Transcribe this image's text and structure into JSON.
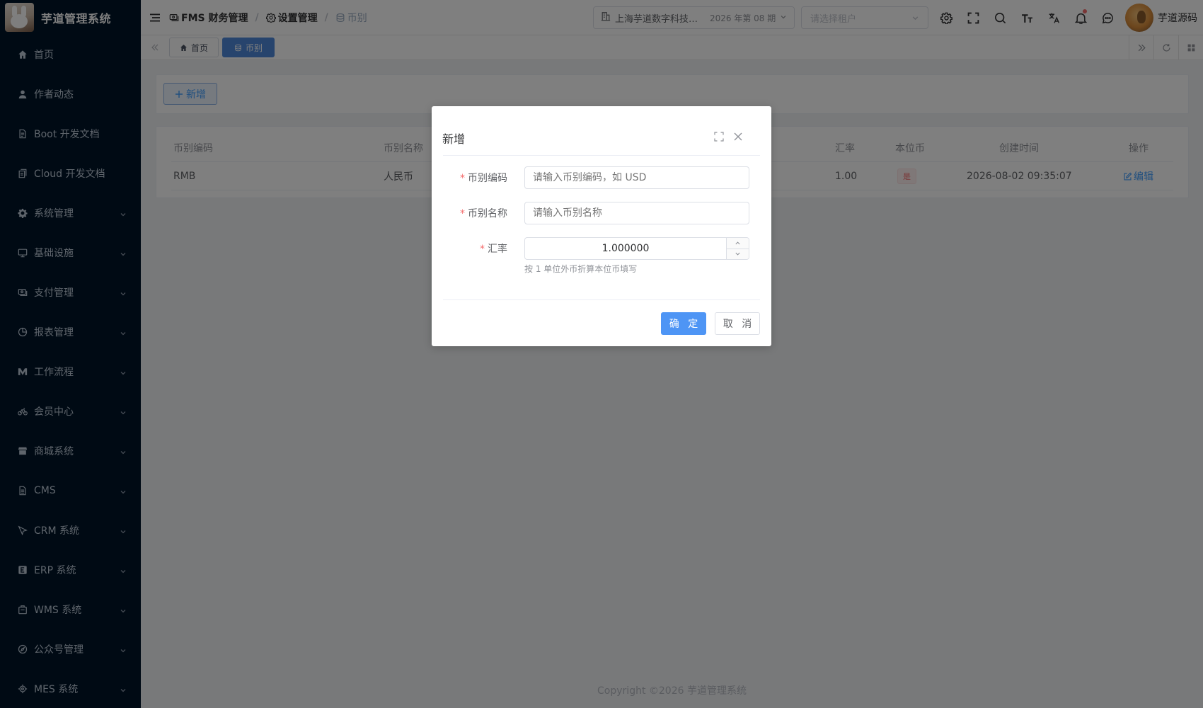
{
  "app": {
    "title": "芋道管理系统"
  },
  "sidebar": {
    "items": [
      {
        "label": "首页",
        "icon": "home-icon",
        "arrow": false
      },
      {
        "label": "作者动态",
        "icon": "user-icon",
        "arrow": false
      },
      {
        "label": "Boot 开发文档",
        "icon": "document-icon",
        "arrow": false
      },
      {
        "label": "Cloud 开发文档",
        "icon": "document-copy-icon",
        "arrow": false
      },
      {
        "label": "系统管理",
        "icon": "gear-icon",
        "arrow": true
      },
      {
        "label": "基础设施",
        "icon": "monitor-icon",
        "arrow": true
      },
      {
        "label": "支付管理",
        "icon": "payment-icon",
        "arrow": true
      },
      {
        "label": "报表管理",
        "icon": "pie-chart-icon",
        "arrow": true
      },
      {
        "label": "工作流程",
        "icon": "workflow-icon",
        "arrow": true
      },
      {
        "label": "会员中心",
        "icon": "bicycle-icon",
        "arrow": true
      },
      {
        "label": "商城系统",
        "icon": "shop-icon",
        "arrow": true
      },
      {
        "label": "CMS",
        "icon": "cms-document-icon",
        "arrow": true
      },
      {
        "label": "CRM 系统",
        "icon": "crm-icon",
        "arrow": true
      },
      {
        "label": "ERP 系统",
        "icon": "erp-icon",
        "arrow": true
      },
      {
        "label": "WMS 系统",
        "icon": "warehouse-icon",
        "arrow": true
      },
      {
        "label": "公众号管理",
        "icon": "compass-icon",
        "arrow": true
      },
      {
        "label": "MES 系统",
        "icon": "cog-icon",
        "arrow": true
      }
    ]
  },
  "header": {
    "breadcrumb": [
      {
        "label": "FMS 财务管理",
        "icon": "finance-icon"
      },
      {
        "label": "设置管理",
        "icon": "gear-icon"
      },
      {
        "label": "币别",
        "icon": "coins-icon"
      }
    ],
    "company": "上海芋道数字科技有限公司",
    "period": "2026 年第 08 期",
    "tenant_placeholder": "请选择租户",
    "user_name": "芋道源码"
  },
  "tags": [
    {
      "label": "首页",
      "icon": "home-icon",
      "active": false
    },
    {
      "label": "币别",
      "icon": "coins-icon",
      "active": true
    }
  ],
  "toolbar": {
    "add_label": "新增"
  },
  "table": {
    "columns": [
      "币别编码",
      "币别名称",
      "汇率",
      "本位币",
      "创建时间",
      "操作"
    ],
    "rows": [
      {
        "code": "RMB",
        "name": "人民币",
        "rate": "1.00",
        "base": "是",
        "created": "2026-08-02 09:35:07",
        "action": "编辑"
      }
    ]
  },
  "dialog": {
    "title": "新增",
    "fields": {
      "code_label": "币别编码",
      "code_placeholder": "请输入币别编码，如 USD",
      "name_label": "币别名称",
      "name_placeholder": "请输入币别名称",
      "rate_label": "汇率",
      "rate_value": "1.000000",
      "rate_tip": "按 1 单位外币折算本位币填写"
    },
    "ok_label": "确 定",
    "cancel_label": "取 消"
  },
  "footer": {
    "copyright": "Copyright ©2026 芋道管理系统"
  },
  "colors": {
    "sidebar_bg": "#001529",
    "primary": "#409eff",
    "active_tag": "#4e89da",
    "danger": "#f56c6c"
  }
}
